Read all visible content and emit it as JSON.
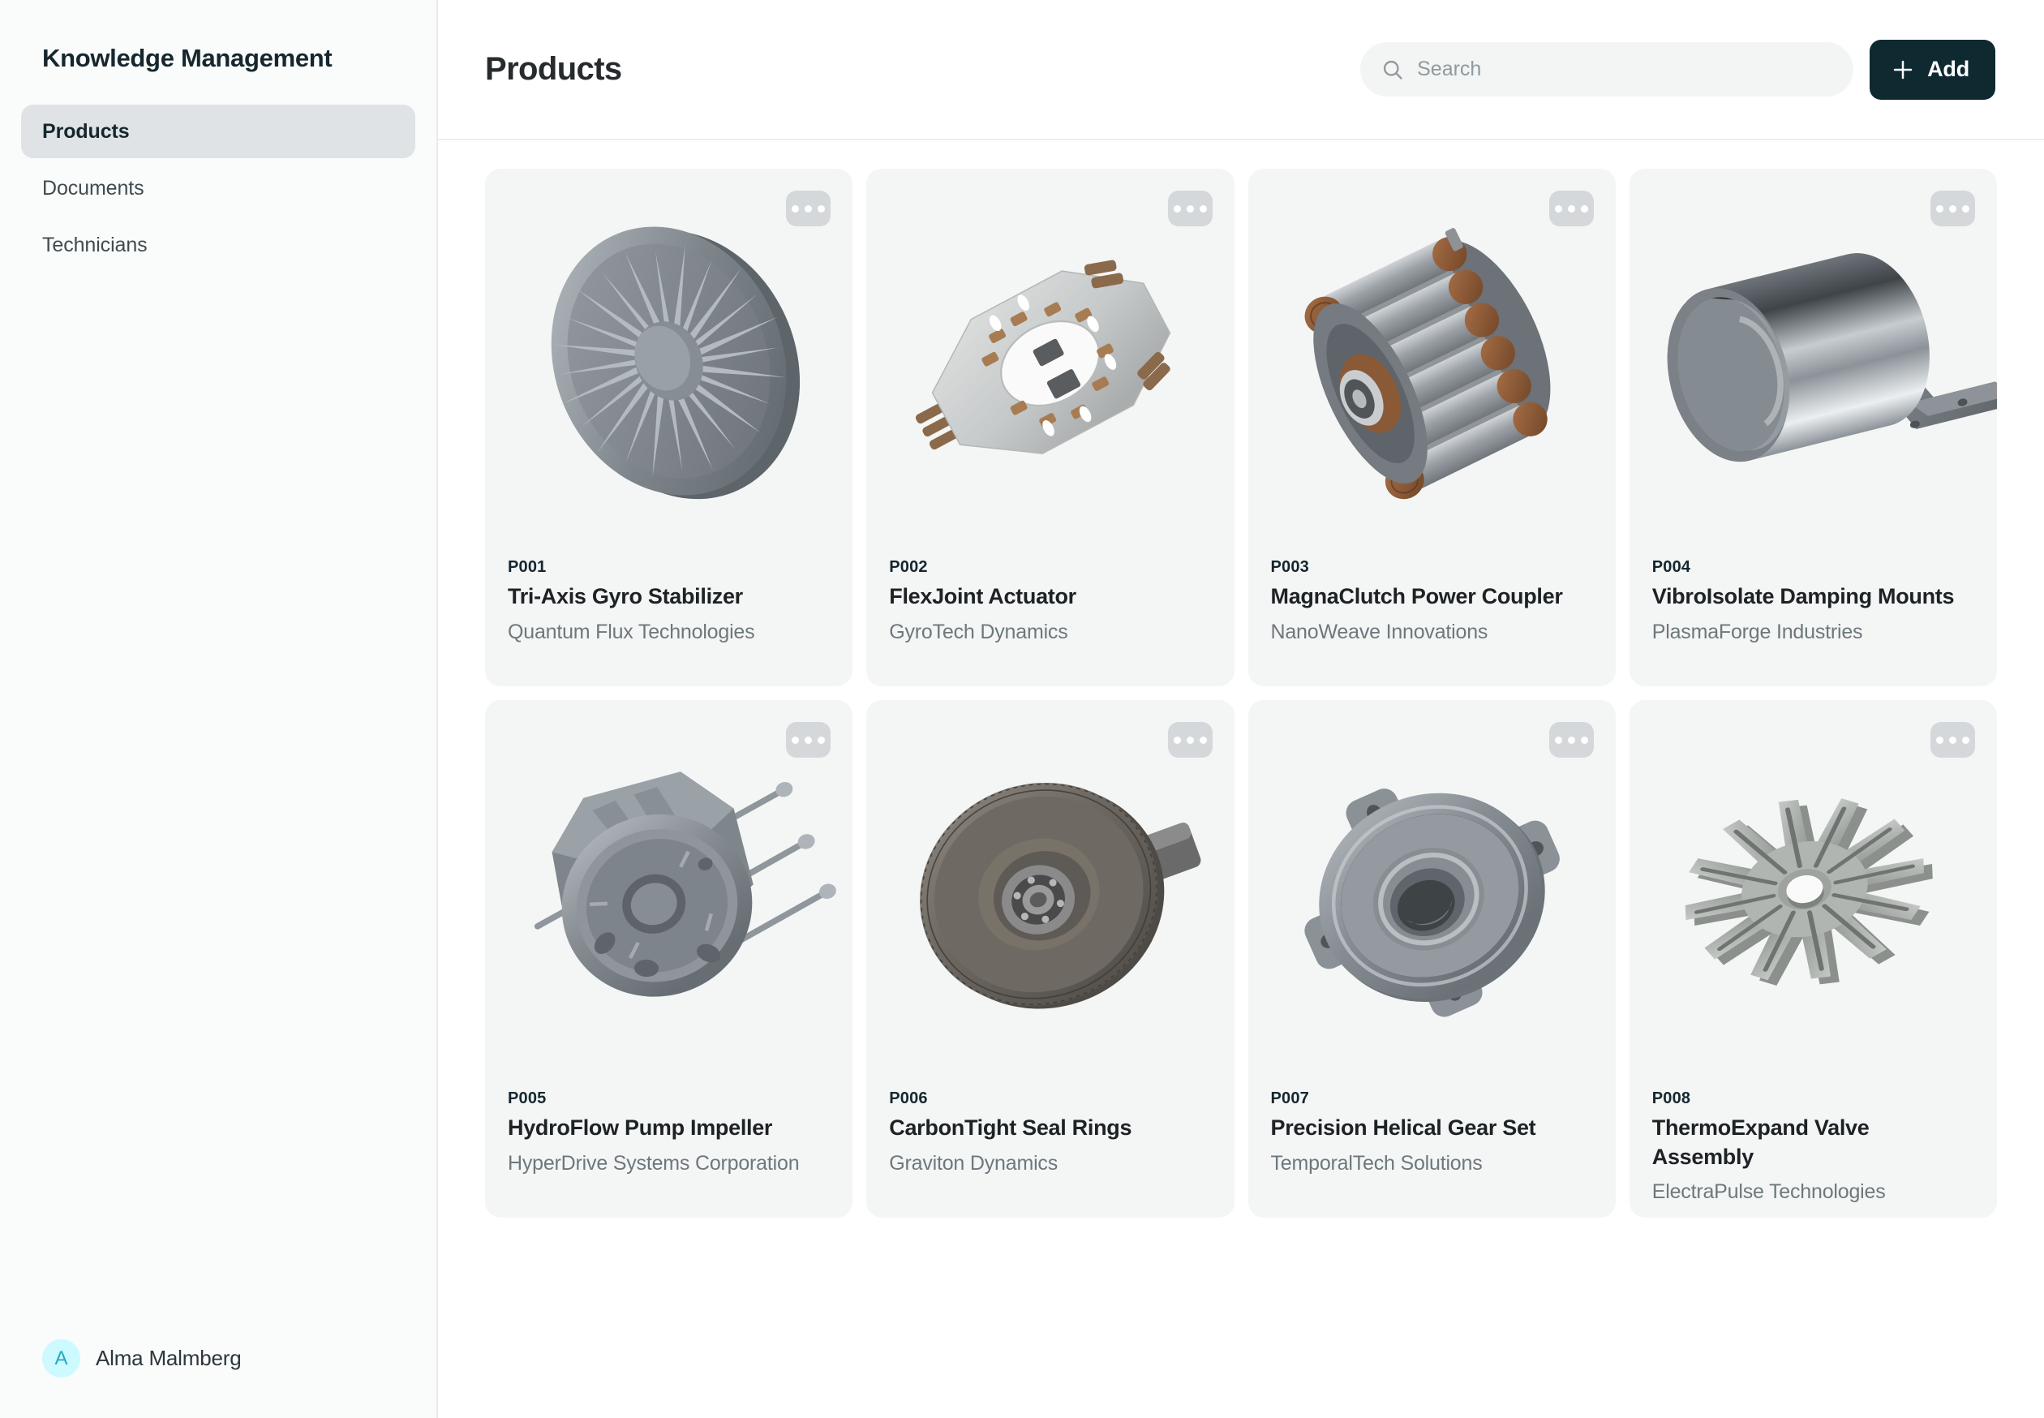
{
  "sidebar": {
    "brand": "Knowledge Management",
    "items": [
      {
        "label": "Products",
        "active": true
      },
      {
        "label": "Documents",
        "active": false
      },
      {
        "label": "Technicians",
        "active": false
      }
    ],
    "user": {
      "initial": "A",
      "name": "Alma Malmberg",
      "avatar_bg": "#cdfaff",
      "avatar_fg": "#1fa9c4"
    }
  },
  "header": {
    "title": "Products",
    "search_placeholder": "Search",
    "search_value": "",
    "add_label": "Add"
  },
  "colors": {
    "accent_dark": "#0e2a30",
    "sidebar_bg": "#fafbfb",
    "card_bg": "#f4f5f5",
    "nav_active_bg": "#dfe3e5",
    "muted_text": "#6d787d"
  },
  "products": [
    {
      "id": "P001",
      "name": "Tri-Axis Gyro Stabilizer",
      "company": "Quantum Flux Technologies",
      "image": "gyro-disc-part-image"
    },
    {
      "id": "P002",
      "name": "FlexJoint Actuator",
      "company": "GyroTech Dynamics",
      "image": "octagonal-plate-part-image"
    },
    {
      "id": "P003",
      "name": "MagnaClutch Power Coupler",
      "company": "NanoWeave Innovations",
      "image": "motor-rotor-windings-part-image"
    },
    {
      "id": "P004",
      "name": "VibroIsolate Damping Mounts",
      "company": "PlasmaForge Industries",
      "image": "metal-sleeve-bracket-part-image"
    },
    {
      "id": "P005",
      "name": "HydroFlow Pump Impeller",
      "company": "HyperDrive Systems Corporation",
      "image": "pump-housing-rods-part-image"
    },
    {
      "id": "P006",
      "name": "CarbonTight Seal Rings",
      "company": "Graviton Dynamics",
      "image": "fine-tooth-gear-part-image"
    },
    {
      "id": "P007",
      "name": "Precision Helical Gear Set",
      "company": "TemporalTech Solutions",
      "image": "gear-housing-cover-part-image"
    },
    {
      "id": "P008",
      "name": "ThermoExpand Valve Assembly",
      "company": "ElectraPulse Technologies",
      "image": "star-fin-impeller-part-image"
    }
  ],
  "card_menu_icon": "ellipsis-icon"
}
